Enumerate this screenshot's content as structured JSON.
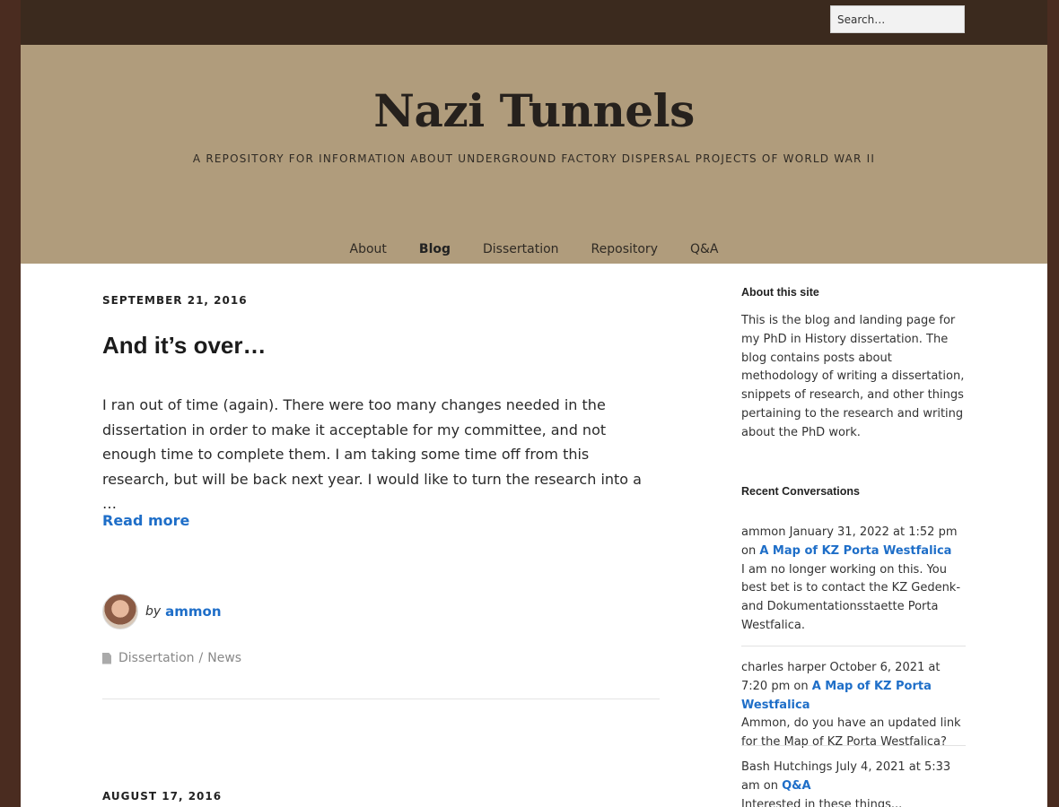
{
  "search": {
    "placeholder": "Search…"
  },
  "site": {
    "title": "Nazi Tunnels",
    "tagline": "A REPOSITORY FOR INFORMATION ABOUT UNDERGROUND FACTORY DISPERSAL PROJECTS OF WORLD WAR II"
  },
  "nav": {
    "about": "About",
    "blog": "Blog",
    "dissertation": "Dissertation",
    "repository": "Repository",
    "qa": "Q&A"
  },
  "post": {
    "date": "SEPTEMBER 21, 2016",
    "title": "And it’s over…",
    "excerpt": "I ran out of time (again). There were too many changes needed in the dissertation in order to make it acceptable for my committee, and not enough time to complete them. I am taking some time off from this research, but will be back next year. I would like to turn the research into a …",
    "read_more": "Read more",
    "by": "by",
    "author": "ammon",
    "category_1": "Dissertation",
    "category_sep": "/",
    "category_2": "News"
  },
  "next_post": {
    "date": "AUGUST 17, 2016"
  },
  "sidebar": {
    "about_title": "About this site",
    "about_text": "This is the blog and landing page for my PhD in History dissertation. The blog contains posts about methodology of writing a dissertation, snippets of research, and other things pertaining to the research and writing about the PhD work.",
    "recent_title": "Recent Conversations",
    "comments": [
      {
        "meta": "ammon January 31, 2022 at 1:52 pm on",
        "link": "A Map of KZ Porta Westfalica",
        "text": "I am no longer working on this. You best bet is to contact the KZ Gedenk- and Dokumentationsstaette Porta Westfalica."
      },
      {
        "meta": "charles harper October 6, 2021 at 7:20 pm on",
        "link": "A Map of KZ Porta Westfalica",
        "text": "Ammon, do you have an updated link for the Map of KZ Porta Westfalica?"
      },
      {
        "meta": "Bash Hutchings July 4, 2021 at 5:33 am on",
        "link": "Q&A",
        "text": "Interested in these things..."
      }
    ]
  },
  "colors": {
    "background": "#4a2c20",
    "topbar": "#3b2a1e",
    "header": "#b09c7c",
    "link": "#1e6ec8"
  },
  "icons": {
    "category": "document-icon",
    "author": "avatar"
  }
}
